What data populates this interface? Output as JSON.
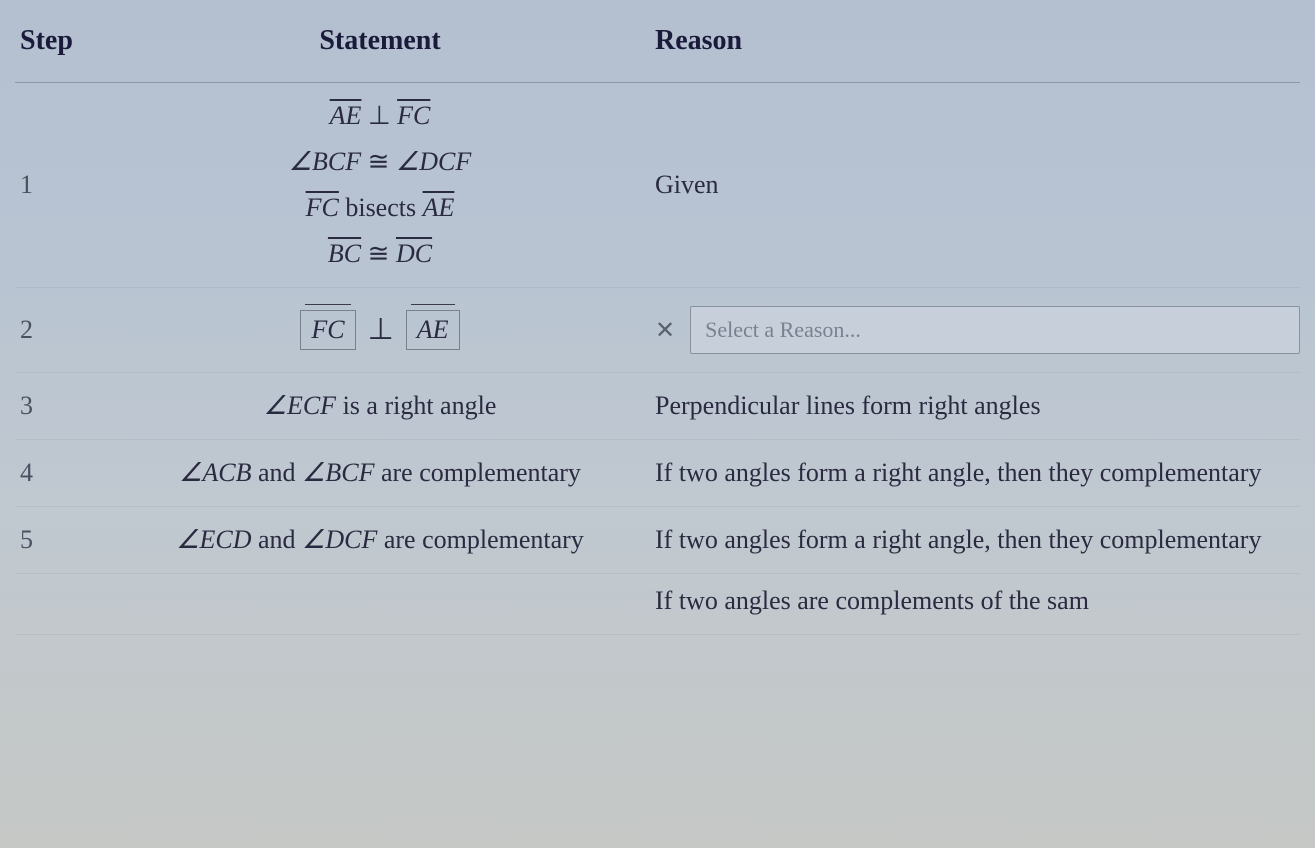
{
  "headers": {
    "step": "Step",
    "statement": "Statement",
    "reason": "Reason"
  },
  "rows": [
    {
      "step": "1",
      "statements": {
        "s1_seg1": "AE",
        "s1_seg2": "FC",
        "s2_ang1": "BCF",
        "s2_ang2": "DCF",
        "s3_seg1": "FC",
        "s3_text": " bisects ",
        "s3_seg2": "AE",
        "s4_seg1": "BC",
        "s4_seg2": "DC"
      },
      "reason": "Given"
    },
    {
      "step": "2",
      "statements": {
        "seg1": "FC",
        "seg2": "AE"
      },
      "reason_placeholder": "Select a Reason..."
    },
    {
      "step": "3",
      "statements": {
        "ang": "ECF",
        "text": " is a right angle"
      },
      "reason": "Perpendicular lines form right angles"
    },
    {
      "step": "4",
      "statements": {
        "ang1": "ACB",
        "mid": " and ",
        "ang2": "BCF",
        "text": " are complementary"
      },
      "reason": "If two angles form a right angle, then they complementary"
    },
    {
      "step": "5",
      "statements": {
        "ang1": "ECD",
        "mid": " and ",
        "ang2": "DCF",
        "text": " are complementary"
      },
      "reason": "If two angles form a right angle, then they complementary"
    }
  ],
  "partial_row6_reason": "If two angles are complements of the sam"
}
